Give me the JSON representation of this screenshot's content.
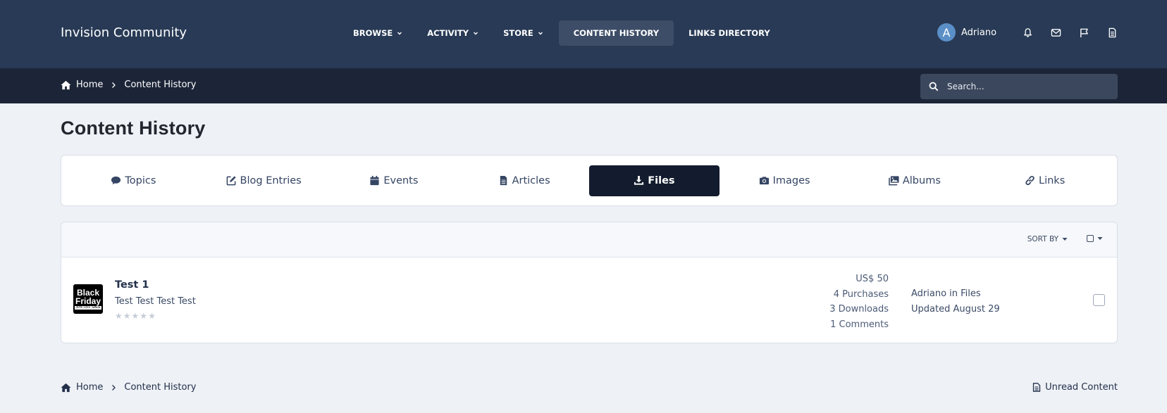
{
  "header": {
    "brand": "Invision Community",
    "nav": [
      {
        "label": "BROWSE",
        "has_dropdown": true
      },
      {
        "label": "ACTIVITY",
        "has_dropdown": true
      },
      {
        "label": "STORE",
        "has_dropdown": true
      },
      {
        "label": "CONTENT HISTORY",
        "active": true
      },
      {
        "label": "LINKS DIRECTORY"
      }
    ],
    "user": {
      "initial": "A",
      "name": "Adriano"
    },
    "icons": [
      "bell-icon",
      "envelope-icon",
      "flag-icon",
      "document-icon"
    ]
  },
  "breadcrumb": {
    "home": "Home",
    "current": "Content History"
  },
  "search": {
    "placeholder": "Search..."
  },
  "page": {
    "title": "Content History"
  },
  "tabs": [
    {
      "label": "Topics",
      "icon": "comment-icon"
    },
    {
      "label": "Blog Entries",
      "icon": "edit-icon"
    },
    {
      "label": "Events",
      "icon": "calendar-icon"
    },
    {
      "label": "Articles",
      "icon": "file-icon"
    },
    {
      "label": "Files",
      "icon": "download-icon",
      "active": true
    },
    {
      "label": "Images",
      "icon": "camera-icon"
    },
    {
      "label": "Albums",
      "icon": "images-icon"
    },
    {
      "label": "Links",
      "icon": "link-icon"
    }
  ],
  "list": {
    "sort_by": "SORT BY",
    "items": [
      {
        "thumb_line1": "Black",
        "thumb_line2": "Friday",
        "thumb_line3": "30% OFF SALE",
        "title": "Test 1",
        "description": "Test Test Test Test",
        "rating": 0,
        "price": "US$ 50",
        "purchases": "4 Purchases",
        "downloads": "3 Downloads",
        "comments": "1 Comments",
        "author_line": "Adriano in Files",
        "updated": "Updated August 29"
      }
    ]
  },
  "footer": {
    "home": "Home",
    "current": "Content History",
    "unread": "Unread Content"
  },
  "colors": {
    "header_bg": "#283a55",
    "crumbbar_bg": "#1c2538",
    "active_tab_bg": "#131c2e",
    "page_bg": "#eef1f6"
  }
}
